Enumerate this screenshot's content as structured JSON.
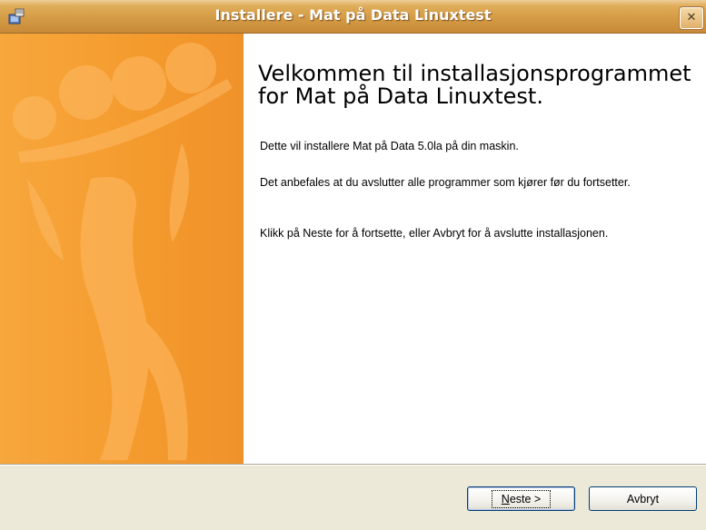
{
  "window": {
    "title": "Installere - Mat på Data Linuxtest",
    "close_label": "✕"
  },
  "content": {
    "heading": "Velkommen til installasjonsprogrammet for Mat på Data Linuxtest.",
    "paragraph1": "Dette vil installere Mat på Data 5.0la på din maskin.",
    "paragraph2": "Det anbefales at du avslutter alle programmer som kjører før du fortsetter.",
    "paragraph3": "Klikk på Neste for å fortsette, eller Avbryt for å avslutte installasjonen."
  },
  "buttons": {
    "next_mnemonic": "N",
    "next_rest": "este >",
    "cancel_label": "Avbryt"
  },
  "colors": {
    "banner": "#f49a2d",
    "titlebar": "#d49b45"
  },
  "icons": {
    "title_icon": "installer-icon",
    "banner_image": "juggler-illustration"
  }
}
